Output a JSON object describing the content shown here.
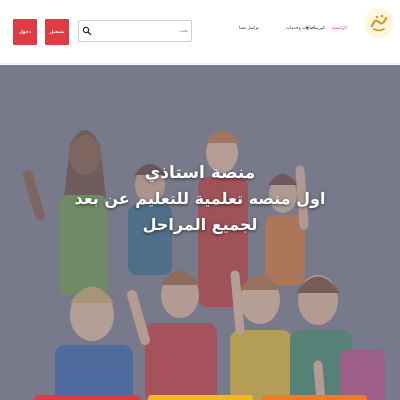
{
  "header": {
    "login_label": "دخول",
    "register_label": "تسجيل",
    "search": {
      "placeholder": "بحث"
    },
    "nav": [
      {
        "label": "الرئيسية",
        "active": true
      },
      {
        "label": "كورسات",
        "has_dropdown": true
      },
      {
        "label": "خيارات وخدمات"
      },
      {
        "label": "تواصل معنا"
      }
    ],
    "accent_color": "#e03a45"
  },
  "hero": {
    "line1": "منصة استاذي",
    "line2": "اول منصه تعلمية للتعليم عن بعد",
    "line3": "لجميع المراحل"
  },
  "cards": [
    {
      "color": "#e03a45"
    },
    {
      "color": "#f2b822"
    },
    {
      "color": "#f07a2a"
    }
  ],
  "icons": {
    "search": "search-icon",
    "logo": "logo-icon",
    "dropdown": "chevron-down-icon"
  }
}
